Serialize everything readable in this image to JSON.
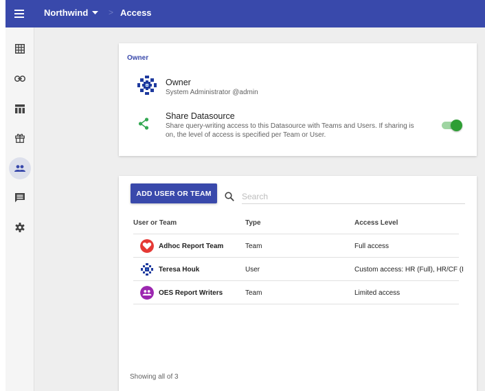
{
  "header": {
    "app_name": "Northwind",
    "breadcrumb_separator": ">",
    "breadcrumb_current": "Access",
    "bar_color": "#3949ab",
    "menu_icon": "hamburger-menu-icon",
    "dropdown_icon": "caret-down-icon"
  },
  "sidebar": {
    "items": [
      {
        "icon": "grid-icon",
        "active": false
      },
      {
        "icon": "link-icon",
        "active": false
      },
      {
        "icon": "table-icon",
        "active": false
      },
      {
        "icon": "gift-icon",
        "active": false
      },
      {
        "icon": "people-icon",
        "active": true
      },
      {
        "icon": "comment-icon",
        "active": false
      },
      {
        "icon": "gear-icon",
        "active": false
      }
    ]
  },
  "owner_card": {
    "heading": "Owner",
    "owner_label": "Owner",
    "owner_detail": "System Administrator @admin",
    "share_title": "Share Datasource",
    "share_description": "Share query-writing access to this Datasource with Teams and Users. If sharing is on, the level of access is specified per Team or User.",
    "share_enabled": true,
    "toggle_color": "#2e9e34"
  },
  "access": {
    "add_button_label": "ADD USER OR TEAM",
    "search_placeholder": "Search",
    "columns": {
      "name": "User or Team",
      "type": "Type",
      "level": "Access Level"
    },
    "rows": [
      {
        "name": "Adhoc Report Team",
        "type": "Team",
        "level": "Full access",
        "avatar": "heart-icon",
        "avatar_color": "#e53935"
      },
      {
        "name": "Teresa Houk",
        "type": "User",
        "level": "Custom access: HR (Full), HR/CF (I",
        "avatar": "pattern-avatar-icon",
        "avatar_color": "#1e3a9e"
      },
      {
        "name": "OES Report Writers",
        "type": "Team",
        "level": "Limited access",
        "avatar": "people-icon",
        "avatar_color": "#9c27b0"
      }
    ],
    "footer": "Showing all of 3"
  }
}
